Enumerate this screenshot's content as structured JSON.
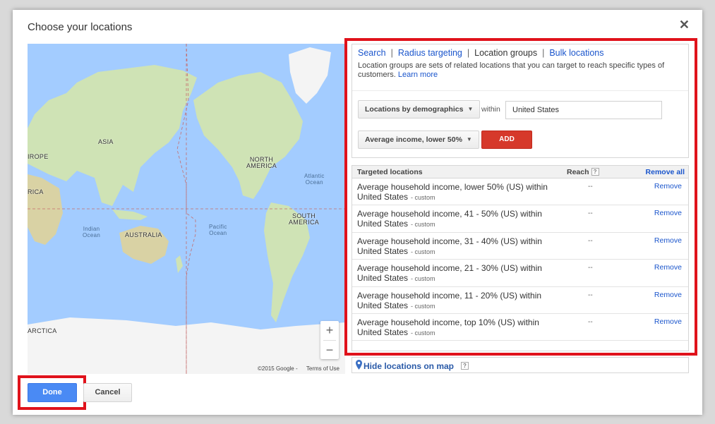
{
  "dialog": {
    "title": "Choose your locations",
    "close_glyph": "✕"
  },
  "map": {
    "labels": {
      "asia": "ASIA",
      "europe": "IROPE",
      "africa": "RICA",
      "north_america": "NORTH\nAMERICA",
      "south_america": "SOUTH\nAMERICA",
      "australia": "AUSTRALIA",
      "antarctica": "ARCTICA",
      "atlantic": "Atlantic\nOcean",
      "pacific": "Pacific\nOcean",
      "indian": "Indian\nOcean"
    },
    "zoom_in": "+",
    "zoom_out": "−",
    "copyright": "©2015 Google -",
    "terms": "Terms of Use"
  },
  "nav": {
    "search": "Search",
    "radius": "Radius targeting",
    "groups": "Location groups",
    "bulk": "Bulk locations",
    "separator": "|"
  },
  "description": {
    "text": "Location groups are sets of related locations that you can target to reach specific types of customers.",
    "learn_more": "Learn more"
  },
  "form": {
    "group_type": "Locations by demographics",
    "within": "within",
    "location_value": "United States",
    "income_option": "Average income, lower 50%",
    "add_label": "ADD",
    "caret": "▼"
  },
  "table": {
    "col_location": "Targeted locations",
    "col_reach": "Reach",
    "help": "?",
    "remove_all": "Remove all",
    "rows": [
      {
        "name": "Average household income, lower 50% (US) within",
        "place": "United States",
        "tag": "- custom",
        "reach": "--",
        "action": "Remove"
      },
      {
        "name": "Average household income, 41 - 50% (US) within",
        "place": "United States",
        "tag": "- custom",
        "reach": "--",
        "action": "Remove"
      },
      {
        "name": "Average household income, 31 - 40% (US) within",
        "place": "United States",
        "tag": "- custom",
        "reach": "--",
        "action": "Remove"
      },
      {
        "name": "Average household income, 21 - 30% (US) within",
        "place": "United States",
        "tag": "- custom",
        "reach": "--",
        "action": "Remove"
      },
      {
        "name": "Average household income, 11 - 20% (US) within",
        "place": "United States",
        "tag": "- custom",
        "reach": "--",
        "action": "Remove"
      },
      {
        "name": "Average household income, top 10% (US) within",
        "place": "United States",
        "tag": "- custom",
        "reach": "--",
        "action": "Remove"
      }
    ]
  },
  "hide_map": {
    "label": "Hide locations on map",
    "help": "?"
  },
  "footer": {
    "done": "Done",
    "cancel": "Cancel"
  },
  "colors": {
    "highlight": "#e0121b",
    "link": "#1a55cc",
    "add_button": "#d6392b",
    "done_button": "#4a8af4",
    "ocean": "#a3ccff",
    "land": "#cfe3b5"
  }
}
